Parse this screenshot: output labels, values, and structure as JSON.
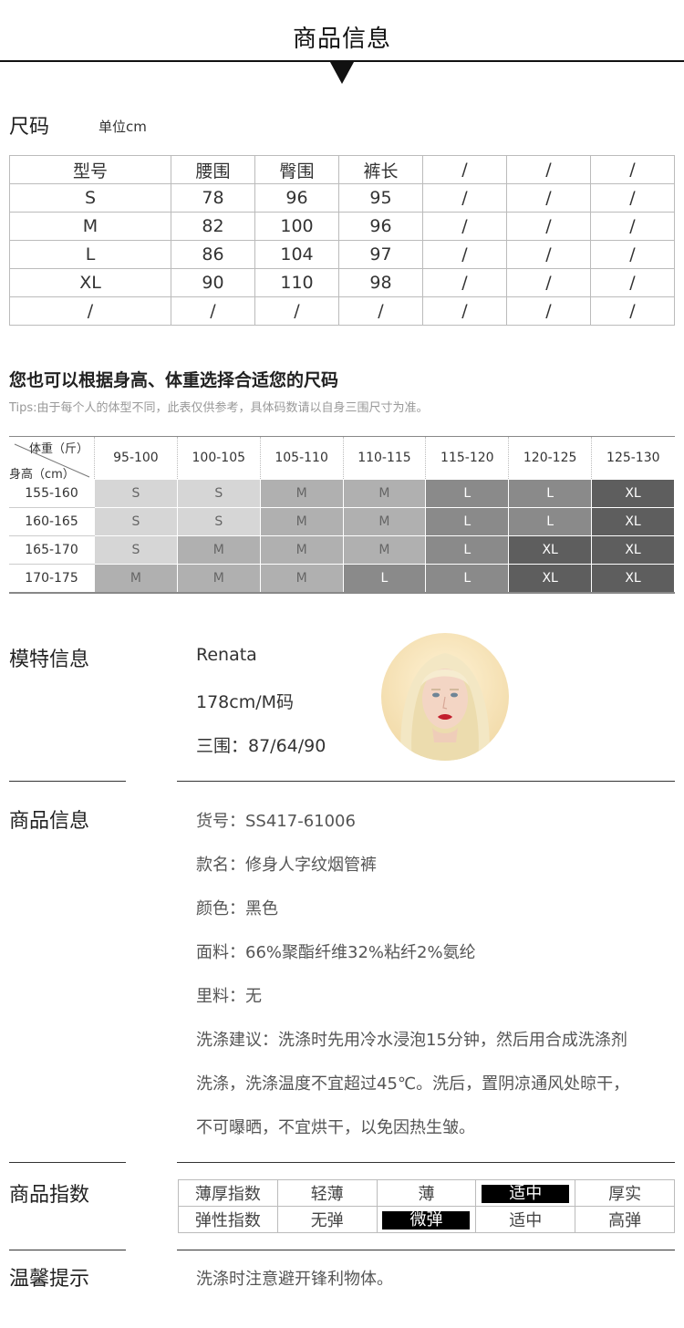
{
  "header": {
    "title": "商品信息"
  },
  "size": {
    "title": "尺码",
    "unit": "单位cm",
    "rows": [
      [
        "型号",
        "腰围",
        "臀围",
        "裤长",
        "/",
        "/",
        "/"
      ],
      [
        "S",
        "78",
        "96",
        "95",
        "/",
        "/",
        "/"
      ],
      [
        "M",
        "82",
        "100",
        "96",
        "/",
        "/",
        "/"
      ],
      [
        "L",
        "86",
        "104",
        "97",
        "/",
        "/",
        "/"
      ],
      [
        "XL",
        "90",
        "110",
        "98",
        "/",
        "/",
        "/"
      ],
      [
        "/",
        "/",
        "/",
        "/",
        "/",
        "/",
        "/"
      ]
    ]
  },
  "recommend": {
    "title": "您也可以根据身高、体重选择合适您的尺码",
    "tips": "Tips:由于每个人的体型不同，此表仅供参考，具体码数请以自身三围尺寸为准。",
    "weight_label": "体重（斤）",
    "height_label": "身高（cm）",
    "weights": [
      "95-100",
      "100-105",
      "105-110",
      "110-115",
      "115-120",
      "120-125",
      "125-130"
    ],
    "heights": [
      "155-160",
      "160-165",
      "165-170",
      "170-175"
    ],
    "cells": [
      [
        "S",
        "S",
        "M",
        "M",
        "L",
        "L",
        "XL"
      ],
      [
        "S",
        "S",
        "M",
        "M",
        "L",
        "L",
        "XL"
      ],
      [
        "S",
        "M",
        "M",
        "M",
        "L",
        "XL",
        "XL"
      ],
      [
        "M",
        "M",
        "M",
        "L",
        "L",
        "XL",
        "XL"
      ]
    ],
    "shade_colors": {
      "S": "#d6d6d6",
      "M": "#b0b0b0",
      "L": "#8a8a8a",
      "XL": "#5e5e5e"
    }
  },
  "model": {
    "title": "模特信息",
    "name": "Renata",
    "height_size": "178cm/M码",
    "measurements": "三围：87/64/90"
  },
  "product": {
    "title": "商品信息",
    "lines": [
      "货号：SS417-61006",
      "款名：修身人字纹烟管裤",
      "颜色：黑色",
      "面料：66%聚酯纤维32%粘纤2%氨纶",
      "里料：无",
      "洗涤建议：洗涤时先用冷水浸泡15分钟，然后用合成洗涤剂",
      "洗涤，洗涤温度不宜超过45℃。洗后，置阴凉通风处晾干，",
      "不可曝晒，不宜烘干，以免因热生皱。"
    ]
  },
  "index": {
    "title": "商品指数",
    "rows": [
      {
        "label": "薄厚指数",
        "options": [
          "轻薄",
          "薄",
          "适中",
          "厚实"
        ],
        "selected": 2
      },
      {
        "label": "弹性指数",
        "options": [
          "无弹",
          "微弹",
          "适中",
          "高弹"
        ],
        "selected": 1
      }
    ]
  },
  "tips": {
    "title": "温馨提示",
    "text": "洗涤时注意避开锋利物体。"
  }
}
